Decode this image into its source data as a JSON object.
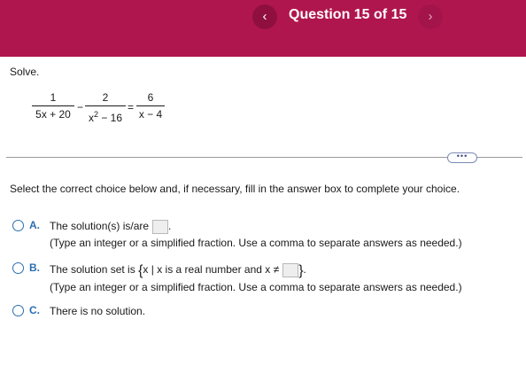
{
  "header": {
    "title": "Question 15 of 15",
    "prev_icon": "‹",
    "next_icon": "›",
    "background": "#b0164e"
  },
  "problem": {
    "instruction": "Solve.",
    "equation": {
      "frac1": {
        "numerator": "1",
        "denominator": "5x + 20"
      },
      "minus": "−",
      "frac2": {
        "numerator": "2",
        "denominator_base": "x",
        "denominator_exp": "2",
        "denominator_rest": " − 16"
      },
      "equals": "=",
      "frac3": {
        "numerator": "6",
        "denominator": "x − 4"
      }
    }
  },
  "more_button": "•••",
  "select_instruction": "Select the correct choice below and, if necessary, fill in the answer box to complete your choice.",
  "choices": [
    {
      "letter": "A.",
      "text": "The solution(s) is/are",
      "suffix": ".",
      "hint": "(Type an integer or a simplified fraction. Use a comma to separate answers as needed.)"
    },
    {
      "letter": "B.",
      "text_prefix": "The solution set is ",
      "brace_open": "{",
      "set_text": "x | x is a real number and x ≠",
      "brace_close": "}",
      "suffix": ".",
      "hint": "(Type an integer or a simplified fraction. Use a comma to separate answers as needed.)"
    },
    {
      "letter": "C.",
      "text": "There is no solution."
    }
  ],
  "colors": {
    "accent": "#2a6eb0",
    "header": "#b0164e"
  }
}
